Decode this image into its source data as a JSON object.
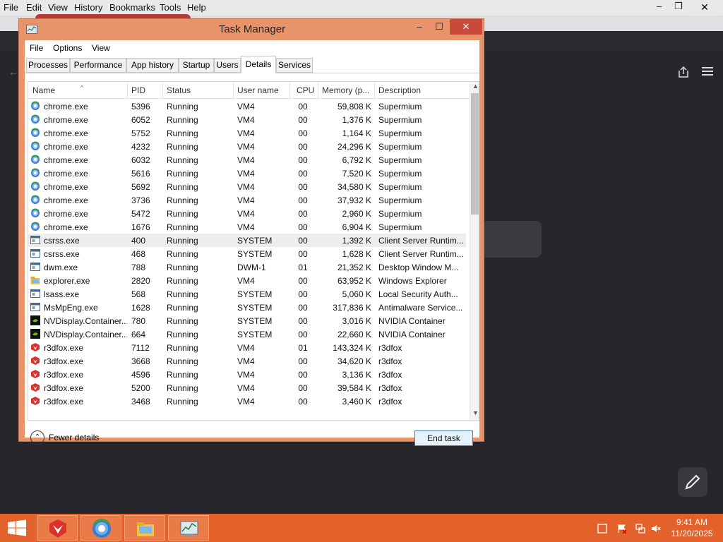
{
  "browser": {
    "menu": [
      "File",
      "Edit",
      "View",
      "History",
      "Bookmarks",
      "Tools",
      "Help"
    ],
    "minimize_glyph": "–",
    "restore_glyph": "❐",
    "close_glyph": "✕",
    "tab_count": "1",
    "back_glyph": "←"
  },
  "task_manager": {
    "title": "Task Manager",
    "minimize_glyph": "–",
    "maximize_glyph": "☐",
    "close_glyph": "✕",
    "menu": [
      "File",
      "Options",
      "View"
    ],
    "tabs": [
      "Processes",
      "Performance",
      "App history",
      "Startup",
      "Users",
      "Details",
      "Services"
    ],
    "active_tab": "Details",
    "columns": [
      "Name",
      "PID",
      "Status",
      "User name",
      "CPU",
      "Memory (p...",
      "Description"
    ],
    "rows": [
      {
        "name": "chrome.exe",
        "pid": "5396",
        "status": "Running",
        "user": "VM4",
        "cpu": "00",
        "memory": "59,808 K",
        "description": "Supermium",
        "icon": "chrome-icon"
      },
      {
        "name": "chrome.exe",
        "pid": "6052",
        "status": "Running",
        "user": "VM4",
        "cpu": "00",
        "memory": "1,376 K",
        "description": "Supermium",
        "icon": "chrome-icon"
      },
      {
        "name": "chrome.exe",
        "pid": "5752",
        "status": "Running",
        "user": "VM4",
        "cpu": "00",
        "memory": "1,164 K",
        "description": "Supermium",
        "icon": "chrome-icon"
      },
      {
        "name": "chrome.exe",
        "pid": "4232",
        "status": "Running",
        "user": "VM4",
        "cpu": "00",
        "memory": "24,296 K",
        "description": "Supermium",
        "icon": "chrome-icon"
      },
      {
        "name": "chrome.exe",
        "pid": "6032",
        "status": "Running",
        "user": "VM4",
        "cpu": "00",
        "memory": "6,792 K",
        "description": "Supermium",
        "icon": "chrome-icon"
      },
      {
        "name": "chrome.exe",
        "pid": "5616",
        "status": "Running",
        "user": "VM4",
        "cpu": "00",
        "memory": "7,520 K",
        "description": "Supermium",
        "icon": "chrome-icon"
      },
      {
        "name": "chrome.exe",
        "pid": "5692",
        "status": "Running",
        "user": "VM4",
        "cpu": "00",
        "memory": "34,580 K",
        "description": "Supermium",
        "icon": "chrome-icon"
      },
      {
        "name": "chrome.exe",
        "pid": "3736",
        "status": "Running",
        "user": "VM4",
        "cpu": "00",
        "memory": "37,932 K",
        "description": "Supermium",
        "icon": "chrome-icon"
      },
      {
        "name": "chrome.exe",
        "pid": "5472",
        "status": "Running",
        "user": "VM4",
        "cpu": "00",
        "memory": "2,960 K",
        "description": "Supermium",
        "icon": "chrome-icon"
      },
      {
        "name": "chrome.exe",
        "pid": "1676",
        "status": "Running",
        "user": "VM4",
        "cpu": "00",
        "memory": "6,904 K",
        "description": "Supermium",
        "icon": "chrome-icon"
      },
      {
        "name": "csrss.exe",
        "pid": "400",
        "status": "Running",
        "user": "SYSTEM",
        "cpu": "00",
        "memory": "1,392 K",
        "description": "Client Server Runtim...",
        "icon": "system-process-icon",
        "selected": true
      },
      {
        "name": "csrss.exe",
        "pid": "468",
        "status": "Running",
        "user": "SYSTEM",
        "cpu": "00",
        "memory": "1,628 K",
        "description": "Client Server Runtim...",
        "icon": "system-process-icon"
      },
      {
        "name": "dwm.exe",
        "pid": "788",
        "status": "Running",
        "user": "DWM-1",
        "cpu": "01",
        "memory": "21,352 K",
        "description": "Desktop Window M...",
        "icon": "system-process-icon"
      },
      {
        "name": "explorer.exe",
        "pid": "2820",
        "status": "Running",
        "user": "VM4",
        "cpu": "00",
        "memory": "63,952 K",
        "description": "Windows Explorer",
        "icon": "folder-icon"
      },
      {
        "name": "lsass.exe",
        "pid": "568",
        "status": "Running",
        "user": "SYSTEM",
        "cpu": "00",
        "memory": "5,060 K",
        "description": "Local Security Auth...",
        "icon": "system-process-icon"
      },
      {
        "name": "MsMpEng.exe",
        "pid": "1628",
        "status": "Running",
        "user": "SYSTEM",
        "cpu": "00",
        "memory": "317,836 K",
        "description": "Antimalware Service...",
        "icon": "system-process-icon"
      },
      {
        "name": "NVDisplay.Container...",
        "pid": "780",
        "status": "Running",
        "user": "SYSTEM",
        "cpu": "00",
        "memory": "3,016 K",
        "description": "NVIDIA Container",
        "icon": "nvidia-icon"
      },
      {
        "name": "NVDisplay.Container...",
        "pid": "664",
        "status": "Running",
        "user": "SYSTEM",
        "cpu": "00",
        "memory": "22,660 K",
        "description": "NVIDIA Container",
        "icon": "nvidia-icon"
      },
      {
        "name": "r3dfox.exe",
        "pid": "7112",
        "status": "Running",
        "user": "VM4",
        "cpu": "01",
        "memory": "143,324 K",
        "description": "r3dfox",
        "icon": "r3dfox-icon"
      },
      {
        "name": "r3dfox.exe",
        "pid": "3668",
        "status": "Running",
        "user": "VM4",
        "cpu": "00",
        "memory": "34,620 K",
        "description": "r3dfox",
        "icon": "r3dfox-icon"
      },
      {
        "name": "r3dfox.exe",
        "pid": "4596",
        "status": "Running",
        "user": "VM4",
        "cpu": "00",
        "memory": "3,136 K",
        "description": "r3dfox",
        "icon": "r3dfox-icon"
      },
      {
        "name": "r3dfox.exe",
        "pid": "5200",
        "status": "Running",
        "user": "VM4",
        "cpu": "00",
        "memory": "39,584 K",
        "description": "r3dfox",
        "icon": "r3dfox-icon"
      },
      {
        "name": "r3dfox.exe",
        "pid": "3468",
        "status": "Running",
        "user": "VM4",
        "cpu": "00",
        "memory": "3,460 K",
        "description": "r3dfox",
        "icon": "r3dfox-icon"
      }
    ],
    "fewer_details_label": "Fewer details",
    "end_task_label": "End task"
  },
  "taskbar": {
    "apps": [
      {
        "name": "r3dfox",
        "icon": "r3dfox-icon"
      },
      {
        "name": "Supermium",
        "icon": "chrome-icon"
      },
      {
        "name": "File Explorer",
        "icon": "folder-icon"
      },
      {
        "name": "Task Manager",
        "icon": "task-manager-icon"
      }
    ],
    "clock_time": "9:41 AM",
    "clock_date": "11/20/2025"
  },
  "colors": {
    "taskbar": "#e3622c",
    "window_frame": "#e8946b",
    "close_button": "#c84a3a",
    "end_task_border": "#3c7fb1"
  }
}
